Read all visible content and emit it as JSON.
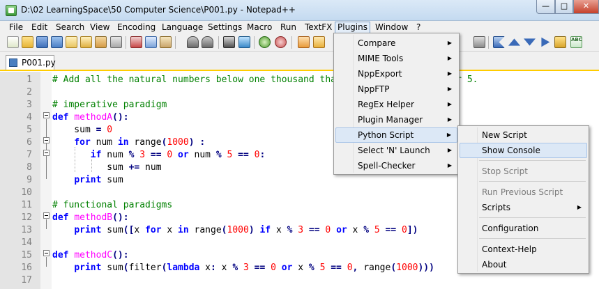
{
  "window": {
    "title": "D:\\02 LearningSpace\\50 Computer Science\\P001.py - Notepad++"
  },
  "menubar": {
    "items": [
      "File",
      "Edit",
      "Search",
      "View",
      "Encoding",
      "Language",
      "Settings",
      "Macro",
      "Run",
      "TextFX",
      "Plugins",
      "Window",
      "?"
    ]
  },
  "toolbar": {
    "icons": [
      "new-file-icon",
      "open-file-icon",
      "save-icon",
      "save-all-icon",
      "close-icon",
      "close-all-icon",
      "print-icon",
      "cut-icon",
      "copy-icon",
      "paste-icon",
      "undo-icon",
      "redo-icon",
      "find-icon",
      "replace-icon",
      "zoom-in-icon",
      "zoom-out-icon",
      "sync-scroll-icon",
      "word-wrap-icon",
      "record-macro-icon",
      "macro-up-icon",
      "macro-down-icon",
      "play-macro-icon",
      "save-macro-icon",
      "spell-check-icon"
    ]
  },
  "tabs": [
    {
      "label": "P001.py",
      "icon": "python-file-icon"
    }
  ],
  "editor": {
    "lines": [
      {
        "num": "1",
        "tokens": [
          [
            "c-com",
            "# Add all the natural numbers below one thousand that are multiples of 3 or 5."
          ]
        ]
      },
      {
        "num": "2",
        "tokens": []
      },
      {
        "num": "3",
        "tokens": [
          [
            "c-com",
            "# imperative paradigm"
          ]
        ]
      },
      {
        "num": "4",
        "tokens": [
          [
            "c-kw",
            "def"
          ],
          [
            "",
            " "
          ],
          [
            "c-def",
            "methodA"
          ],
          [
            "c-op",
            "():"
          ]
        ]
      },
      {
        "num": "5",
        "tokens": [
          [
            "",
            "    sum "
          ],
          [
            "c-op",
            "="
          ],
          [
            "",
            " "
          ],
          [
            "c-num",
            "0"
          ]
        ]
      },
      {
        "num": "6",
        "tokens": [
          [
            "",
            "    "
          ],
          [
            "c-kw",
            "for"
          ],
          [
            "",
            " num "
          ],
          [
            "c-kw",
            "in"
          ],
          [
            "",
            " range"
          ],
          [
            "c-op",
            "("
          ],
          [
            "c-num",
            "1000"
          ],
          [
            "c-op",
            ")"
          ],
          [
            "",
            " "
          ],
          [
            "c-op",
            ":"
          ]
        ]
      },
      {
        "num": "7",
        "tokens": [
          [
            "",
            "       "
          ],
          [
            "c-kw",
            "if"
          ],
          [
            "",
            " num "
          ],
          [
            "c-op",
            "%"
          ],
          [
            "",
            " "
          ],
          [
            "c-num",
            "3"
          ],
          [
            "",
            " "
          ],
          [
            "c-op",
            "=="
          ],
          [
            "",
            " "
          ],
          [
            "c-num",
            "0"
          ],
          [
            "",
            " "
          ],
          [
            "c-kw",
            "or"
          ],
          [
            "",
            " num "
          ],
          [
            "c-op",
            "%"
          ],
          [
            "",
            " "
          ],
          [
            "c-num",
            "5"
          ],
          [
            "",
            " "
          ],
          [
            "c-op",
            "=="
          ],
          [
            "",
            " "
          ],
          [
            "c-num",
            "0"
          ],
          [
            "c-op",
            ":"
          ]
        ]
      },
      {
        "num": "8",
        "tokens": [
          [
            "",
            "          sum "
          ],
          [
            "c-op",
            "+="
          ],
          [
            "",
            " num"
          ]
        ]
      },
      {
        "num": "9",
        "tokens": [
          [
            "",
            "    "
          ],
          [
            "c-kw",
            "print"
          ],
          [
            "",
            " sum"
          ]
        ]
      },
      {
        "num": "10",
        "tokens": []
      },
      {
        "num": "11",
        "tokens": [
          [
            "c-com",
            "# functional paradigms"
          ]
        ]
      },
      {
        "num": "12",
        "tokens": [
          [
            "c-kw",
            "def"
          ],
          [
            "",
            " "
          ],
          [
            "c-def",
            "methodB"
          ],
          [
            "c-op",
            "():"
          ]
        ]
      },
      {
        "num": "13",
        "tokens": [
          [
            "",
            "    "
          ],
          [
            "c-kw",
            "print"
          ],
          [
            "",
            " sum"
          ],
          [
            "c-op",
            "(["
          ],
          [
            "",
            "x "
          ],
          [
            "c-kw",
            "for"
          ],
          [
            "",
            " x "
          ],
          [
            "c-kw",
            "in"
          ],
          [
            "",
            " range"
          ],
          [
            "c-op",
            "("
          ],
          [
            "c-num",
            "1000"
          ],
          [
            "c-op",
            ")"
          ],
          [
            "",
            " "
          ],
          [
            "c-kw",
            "if"
          ],
          [
            "",
            " x "
          ],
          [
            "c-op",
            "%"
          ],
          [
            "",
            " "
          ],
          [
            "c-num",
            "3"
          ],
          [
            "",
            " "
          ],
          [
            "c-op",
            "=="
          ],
          [
            "",
            " "
          ],
          [
            "c-num",
            "0"
          ],
          [
            "",
            " "
          ],
          [
            "c-kw",
            "or"
          ],
          [
            "",
            " x "
          ],
          [
            "c-op",
            "%"
          ],
          [
            "",
            " "
          ],
          [
            "c-num",
            "5"
          ],
          [
            "",
            " "
          ],
          [
            "c-op",
            "=="
          ],
          [
            "",
            " "
          ],
          [
            "c-num",
            "0"
          ],
          [
            "c-op",
            "])"
          ]
        ]
      },
      {
        "num": "14",
        "tokens": []
      },
      {
        "num": "15",
        "tokens": [
          [
            "c-kw",
            "def"
          ],
          [
            "",
            " "
          ],
          [
            "c-def",
            "methodC"
          ],
          [
            "c-op",
            "():"
          ]
        ]
      },
      {
        "num": "16",
        "tokens": [
          [
            "",
            "    "
          ],
          [
            "c-kw",
            "print"
          ],
          [
            "",
            " sum"
          ],
          [
            "c-op",
            "("
          ],
          [
            "",
            "filter"
          ],
          [
            "c-op",
            "("
          ],
          [
            "c-kw",
            "lambda"
          ],
          [
            "",
            " x"
          ],
          [
            "c-op",
            ":"
          ],
          [
            "",
            " x "
          ],
          [
            "c-op",
            "%"
          ],
          [
            "",
            " "
          ],
          [
            "c-num",
            "3"
          ],
          [
            "",
            " "
          ],
          [
            "c-op",
            "=="
          ],
          [
            "",
            " "
          ],
          [
            "c-num",
            "0"
          ],
          [
            "",
            " "
          ],
          [
            "c-kw",
            "or"
          ],
          [
            "",
            " x "
          ],
          [
            "c-op",
            "%"
          ],
          [
            "",
            " "
          ],
          [
            "c-num",
            "5"
          ],
          [
            "",
            " "
          ],
          [
            "c-op",
            "=="
          ],
          [
            "",
            " "
          ],
          [
            "c-num",
            "0"
          ],
          [
            "c-op",
            ","
          ],
          [
            "",
            " range"
          ],
          [
            "c-op",
            "("
          ],
          [
            "c-num",
            "1000"
          ],
          [
            "c-op",
            ")))"
          ]
        ]
      },
      {
        "num": "17",
        "tokens": []
      }
    ]
  },
  "plugins_menu": {
    "items": [
      {
        "label": "Compare",
        "submenu": true
      },
      {
        "label": "MIME Tools",
        "submenu": true
      },
      {
        "label": "NppExport",
        "submenu": true
      },
      {
        "label": "NppFTP",
        "submenu": true
      },
      {
        "label": "RegEx Helper",
        "submenu": true
      },
      {
        "label": "Plugin Manager",
        "submenu": true
      },
      {
        "label": "Python Script",
        "submenu": true,
        "highlighted": true
      },
      {
        "label": "Select 'N' Launch",
        "submenu": true
      },
      {
        "label": "Spell-Checker",
        "submenu": true
      }
    ]
  },
  "python_script_menu": {
    "items": [
      {
        "label": "New Script"
      },
      {
        "label": "Show Console",
        "highlighted": true
      },
      {
        "label": "Stop Script",
        "disabled": true
      },
      {
        "label": "Run Previous Script",
        "disabled": true
      },
      {
        "label": "Scripts",
        "submenu": true
      },
      {
        "label": "Configuration"
      },
      {
        "label": "Context-Help"
      },
      {
        "label": "About"
      }
    ]
  },
  "colors": {
    "comment": "#008000",
    "keyword": "#0000ff",
    "function_name": "#ff00ff",
    "number": "#ff0000",
    "operator": "#000080",
    "line_number_gutter": "#e4e4e4",
    "menu_highlight": "#dce8f6",
    "tab_accent": "#ffcc00"
  }
}
